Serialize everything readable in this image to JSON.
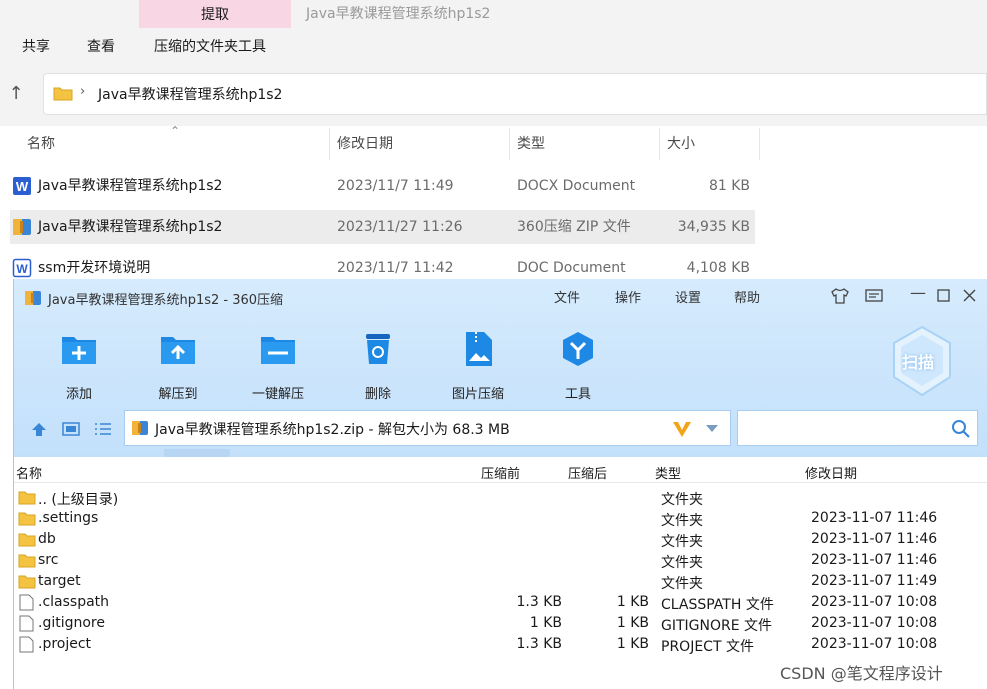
{
  "explorer": {
    "context_tab": "提取",
    "window_title": "Java早教课程管理系统hp1s2",
    "ribbon_tabs": [
      "共享",
      "查看",
      "压缩的文件夹工具"
    ],
    "address": "Java早教课程管理系统hp1s2",
    "columns": [
      "名称",
      "修改日期",
      "类型",
      "大小"
    ],
    "rows": [
      {
        "name": "Java早教课程管理系统hp1s2",
        "date": "2023/11/7 11:49",
        "type": "DOCX Document",
        "size": "81 KB",
        "icon": "word-doc-icon"
      },
      {
        "name": "Java早教课程管理系统hp1s2",
        "date": "2023/11/27 11:26",
        "type": "360压缩 ZIP 文件",
        "size": "34,935 KB",
        "icon": "zip-archive-icon"
      },
      {
        "name": "ssm开发环境说明",
        "date": "2023/11/7 11:42",
        "type": "DOC Document",
        "size": "4,108 KB",
        "icon": "word-doc-outline-icon"
      }
    ]
  },
  "zip": {
    "title": "Java早教课程管理系统hp1s2 - 360压缩",
    "menu": [
      "文件",
      "操作",
      "设置",
      "帮助"
    ],
    "tools": [
      "添加",
      "解压到",
      "一键解压",
      "删除",
      "图片压缩",
      "工具"
    ],
    "scan_label": "扫描",
    "path": "Java早教课程管理系统hp1s2.zip - 解包大小为 68.3 MB",
    "columns": [
      "名称",
      "压缩前",
      "压缩后",
      "类型",
      "修改日期"
    ],
    "rows": [
      {
        "name": ".. (上级目录)",
        "before": "",
        "after": "",
        "type": "文件夹",
        "date": "",
        "kind": "folder"
      },
      {
        "name": ".settings",
        "before": "",
        "after": "",
        "type": "文件夹",
        "date": "2023-11-07 11:46",
        "kind": "folder"
      },
      {
        "name": "db",
        "before": "",
        "after": "",
        "type": "文件夹",
        "date": "2023-11-07 11:46",
        "kind": "folder"
      },
      {
        "name": "src",
        "before": "",
        "after": "",
        "type": "文件夹",
        "date": "2023-11-07 11:46",
        "kind": "folder"
      },
      {
        "name": "target",
        "before": "",
        "after": "",
        "type": "文件夹",
        "date": "2023-11-07 11:49",
        "kind": "folder"
      },
      {
        "name": ".classpath",
        "before": "1.3 KB",
        "after": "1 KB",
        "type": "CLASSPATH 文件",
        "date": "2023-11-07 10:08",
        "kind": "file"
      },
      {
        "name": ".gitignore",
        "before": "1 KB",
        "after": "1 KB",
        "type": "GITIGNORE 文件",
        "date": "2023-11-07 10:08",
        "kind": "file"
      },
      {
        "name": ".project",
        "before": "1.3 KB",
        "after": "1 KB",
        "type": "PROJECT 文件",
        "date": "2023-11-07 10:08",
        "kind": "file"
      }
    ]
  },
  "watermark": "CSDN @笔文程序设计",
  "colors": {
    "accent": "#1e88e5",
    "ctx_tab": "#f8d6e4",
    "folder": "#f5c342"
  }
}
